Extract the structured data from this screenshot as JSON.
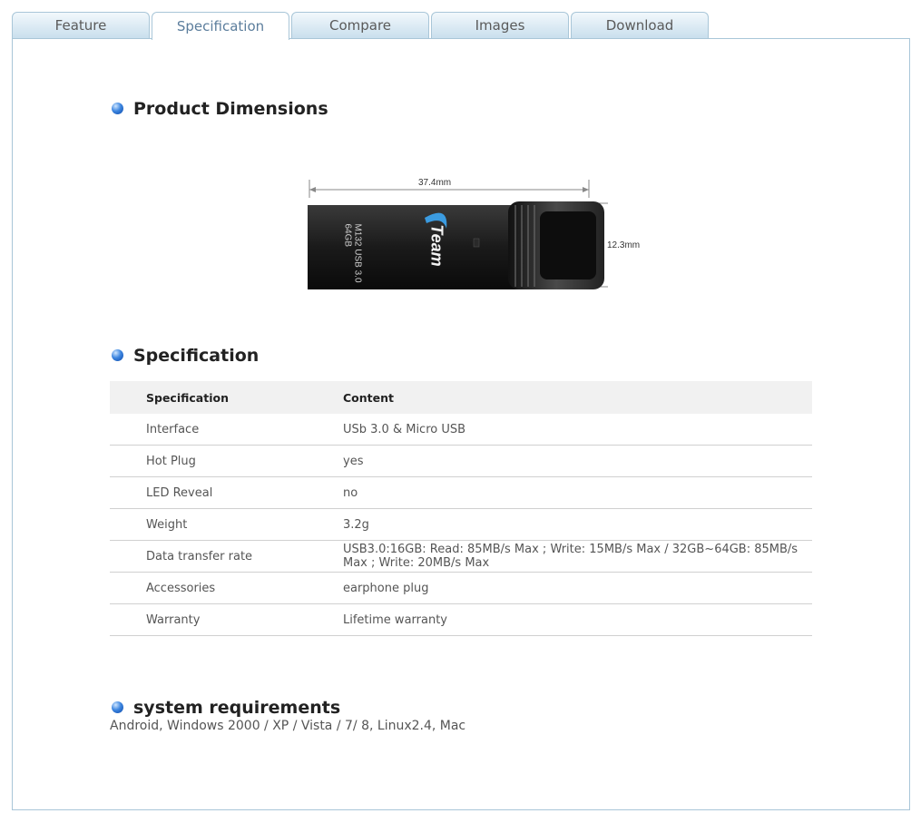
{
  "tabs": [
    {
      "label": "Feature"
    },
    {
      "label": "Specification"
    },
    {
      "label": "Compare"
    },
    {
      "label": "Images"
    },
    {
      "label": "Download"
    }
  ],
  "active_tab": "Specification",
  "sections": {
    "dimensions": {
      "title": "Product Dimensions",
      "width_label": "37.4mm",
      "height_label": "12.3mm",
      "device_brand": "Team",
      "device_print_line1": "M132 USB 3.0",
      "device_print_line2": "64GB"
    },
    "specification": {
      "title": "Specification",
      "headers": [
        "Specification",
        "Content"
      ],
      "rows": [
        {
          "name": "Interface",
          "value": "USb 3.0 & Micro USB"
        },
        {
          "name": "Hot Plug",
          "value": "yes"
        },
        {
          "name": "LED Reveal",
          "value": "no"
        },
        {
          "name": "Weight",
          "value": "3.2g"
        },
        {
          "name": "Data transfer rate",
          "value": "USB3.0:16GB: Read: 85MB/s Max ; Write: 15MB/s Max / 32GB~64GB: 85MB/s Max ; Write: 20MB/s Max"
        },
        {
          "name": "Accessories",
          "value": "earphone plug"
        },
        {
          "name": "Warranty",
          "value": "Lifetime warranty"
        }
      ]
    },
    "system_requirements": {
      "title": "system requirements",
      "text": "Android, Windows 2000 / XP / Vista / 7/ 8, Linux2.4, Mac"
    }
  }
}
